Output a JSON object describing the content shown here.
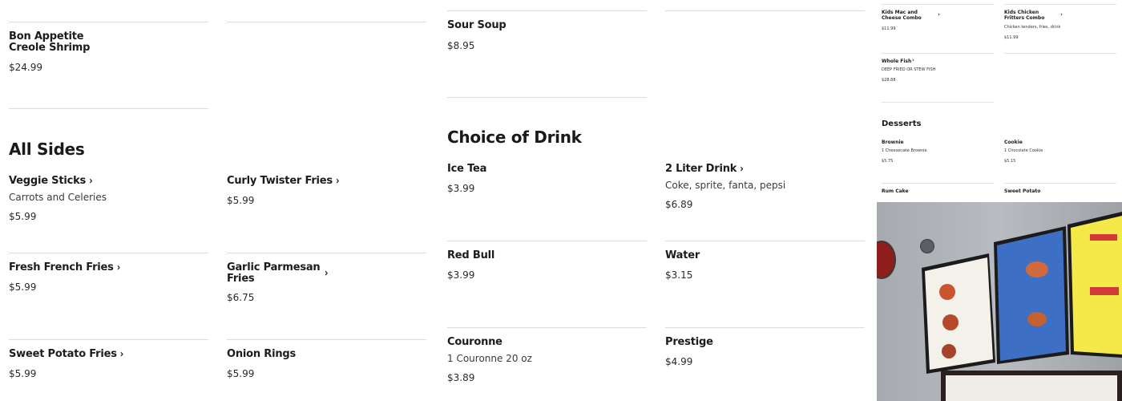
{
  "column1": {
    "top_item": {
      "name": "Bon Appetite Creole Shrimp",
      "price": "$24.99"
    },
    "section_title": "All Sides",
    "items": [
      {
        "name": "Veggie Sticks",
        "desc": "Carrots and Celeries",
        "price": "$5.99"
      },
      {
        "name": "Fresh French Fries",
        "price": "$5.99"
      },
      {
        "name": "Sweet Potato Fries",
        "price": "$5.99"
      }
    ]
  },
  "column2": {
    "items": [
      {
        "name": "Curly Twister Fries",
        "price": "$5.99"
      },
      {
        "name": "Garlic Parmesan Fries",
        "price": "$6.75"
      },
      {
        "name": "Onion Rings",
        "price": "$5.99"
      }
    ]
  },
  "column3": {
    "top_item": {
      "name": "Sour Soup",
      "price": "$8.95"
    },
    "section_title": "Choice of Drink",
    "items": [
      {
        "name": "Ice Tea",
        "price": "$3.99"
      },
      {
        "name": "Red Bull",
        "price": "$3.99"
      },
      {
        "name": "Couronne",
        "desc": "1 Couronne 20 oz",
        "price": "$3.89"
      }
    ]
  },
  "column4": {
    "items": [
      {
        "name": "2 Liter Drink",
        "desc": "Coke, sprite, fanta, pepsi",
        "price": "$6.89"
      },
      {
        "name": "Water",
        "price": "$3.15"
      },
      {
        "name": "Prestige",
        "price": "$4.99"
      }
    ]
  },
  "mini_panel": {
    "items": [
      {
        "name": "Kids Mac and Cheese Combo",
        "price": "$11.99"
      },
      {
        "name": "Kids Chicken Fritters Combo",
        "desc": "Chicken tenders, fries, drink",
        "price": "$11.99"
      },
      {
        "name": "Whole Fish",
        "desc": "DEEP FRIED OR STEW FISH",
        "price": "$28.88"
      }
    ],
    "desserts_title": "Desserts",
    "desserts": [
      {
        "name": "Brownie",
        "desc": "1 Cheesecake Brownie",
        "price": "$5.75"
      },
      {
        "name": "Cookie",
        "desc": "1 Chocolate Cookie",
        "price": "$5.15"
      },
      {
        "name": "Rum Cake"
      },
      {
        "name": "Sweet Potato"
      }
    ]
  },
  "icons": {
    "chevron": "›"
  },
  "colors": {
    "accent_red": "#b02a2a",
    "screen_yellow": "#f5e94a",
    "screen_blue": "#3d6fc4"
  }
}
